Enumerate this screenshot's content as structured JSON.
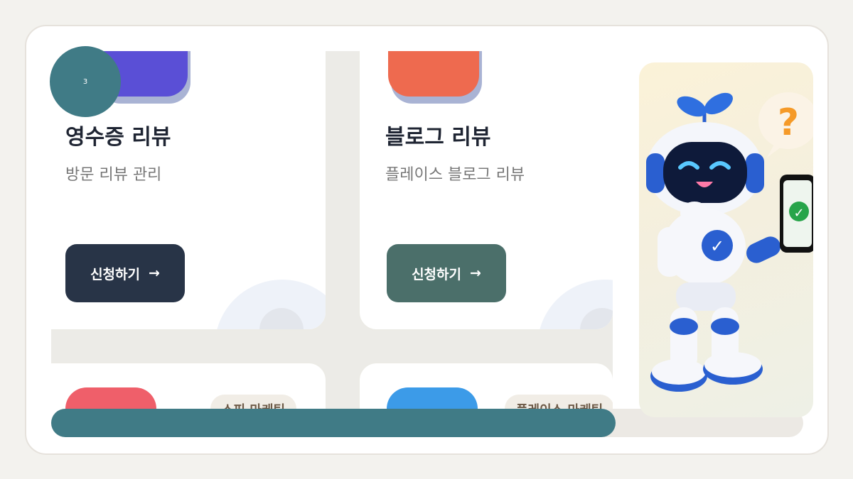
{
  "slide": {
    "number": "3",
    "progress": 0.75
  },
  "cards": [
    {
      "title": "영수증 리뷰",
      "subtitle": "방문 리뷰 관리",
      "button": "신청하기",
      "arrow": "→",
      "icon_color": "#5a4fd6",
      "button_color": "#283447"
    },
    {
      "title": "블로그 리뷰",
      "subtitle": "플레이스 블로그 리뷰",
      "button": "신청하기",
      "arrow": "→",
      "icon_color": "#ee6a4f",
      "button_color": "#4b6f6a"
    }
  ],
  "bottom_cards": [
    {
      "badge": "스피 마케팅",
      "icon_color": "#ef5f6a"
    },
    {
      "badge": "플레이스 마케팅",
      "icon_color": "#3c9be8"
    }
  ],
  "mascot": {
    "bubble": "?",
    "phone_check": "✓",
    "chest_check": "✓"
  },
  "colors": {
    "accent": "#407b86",
    "card_bg": "#ffffff",
    "page_bg": "#f3f2ee"
  }
}
